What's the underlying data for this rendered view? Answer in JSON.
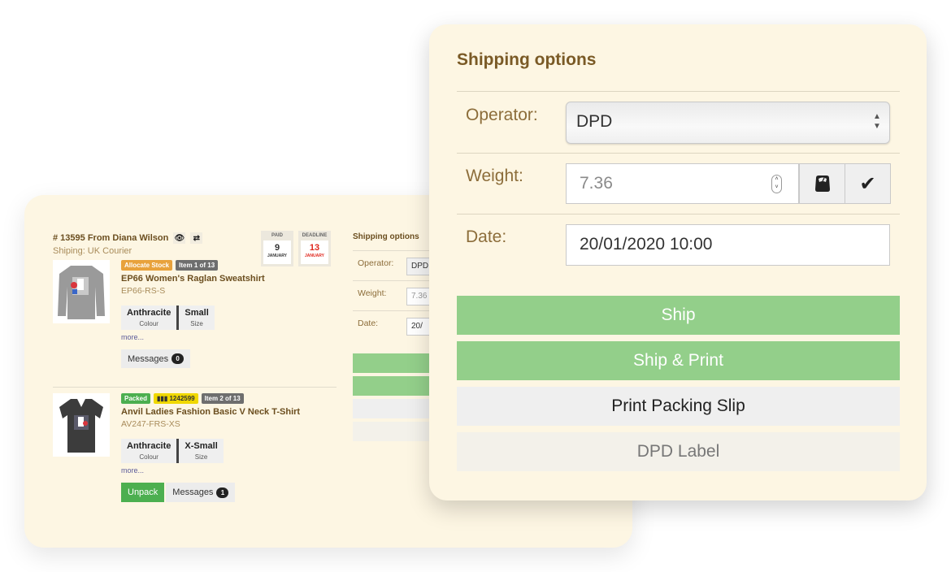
{
  "order": {
    "title": "# 13595 From Diana Wilson",
    "shipping": "Shiping: UK Courier",
    "view_icon": "eye-icon",
    "shuffle_icon": "shuffle-icon",
    "paid": {
      "label": "PAID",
      "day": "9",
      "month": "JANUARY"
    },
    "deadline": {
      "label": "DEADLINE",
      "day": "13",
      "month": "JANUARY",
      "color": "#e0261c"
    }
  },
  "items": [
    {
      "badges": [
        "Allocate Stock",
        "Item 1 of 13"
      ],
      "name": "EP66 Women's Raglan Sweatshirt",
      "sku": "EP66-RS-S",
      "attributes": [
        {
          "value": "Anthracite",
          "key": "Colour"
        },
        {
          "value": "Small",
          "key": "Size"
        }
      ],
      "more": "more...",
      "messages_label": "Messages",
      "messages_count": "0"
    },
    {
      "badges": [
        "Packed",
        "1242599",
        "Item 2 of 13"
      ],
      "name": "Anvil Ladies Fashion Basic V Neck T-Shirt",
      "sku": "AV247-FRS-XS",
      "attributes": [
        {
          "value": "Anthracite",
          "key": "Colour"
        },
        {
          "value": "X-Small",
          "key": "Size"
        }
      ],
      "more": "more...",
      "unpack_label": "Unpack",
      "messages_label": "Messages",
      "messages_count": "1"
    }
  ],
  "shipping_options": {
    "title": "Shipping options",
    "operator_label": "Operator:",
    "operator_value": "DPD",
    "weight_label": "Weight:",
    "weight_value": "7.36",
    "date_label": "Date:",
    "date_value": "20/01/2020 10:00",
    "mini_operator_value": "DPD",
    "mini_weight_value": "7.36",
    "mini_date_value": "20/",
    "buttons": {
      "ship": "Ship",
      "ship_print": "Ship & Print",
      "packing_slip": "Print Packing Slip",
      "label": "DPD Label"
    }
  },
  "colors": {
    "card_bg": "#fdf6e3",
    "accent_brown": "#7a5a26",
    "ship_green": "#93cf8a",
    "packed_green": "#4caf50",
    "allocate_orange": "#e8a23c"
  }
}
